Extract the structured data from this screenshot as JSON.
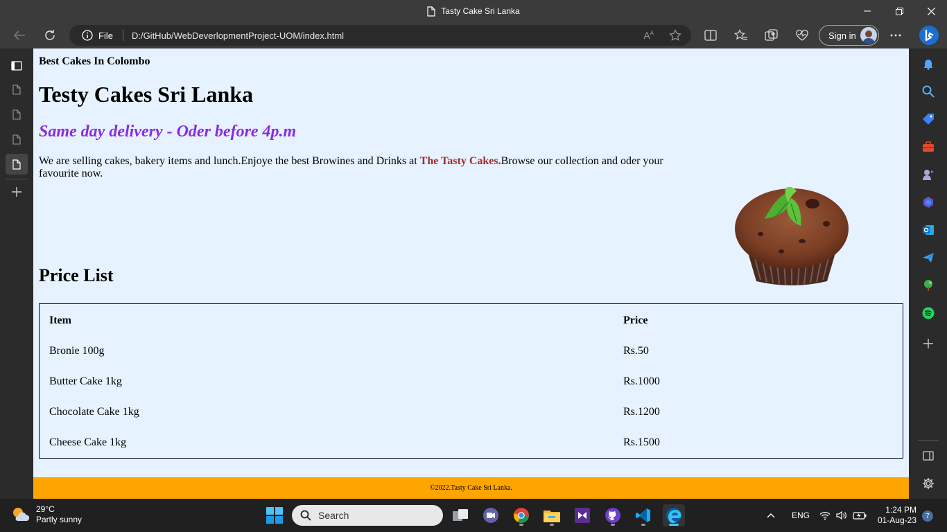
{
  "window": {
    "title": "Tasty Cake Sri Lanka",
    "minimize_icon": "minimize-icon",
    "restore_icon": "restore-icon",
    "close_icon": "close-icon"
  },
  "toolbar": {
    "info_label": "File",
    "url": "D:/GitHub/WebDeverlopmentProject-UOM/index.html",
    "signin_label": "Sign in"
  },
  "page": {
    "topline": "Best Cakes In Colombo",
    "heading": "Testy Cakes Sri Lanka",
    "tagline": "Same day delivery - Oder before 4p.m",
    "para_before": "We are selling cakes, bakery items and lunch.Enjoye the best Browines and Drinks at ",
    "para_brand": "The Tasty Cakes.",
    "para_after": "Browse our collection and oder your favourite now.",
    "price_title": "Price List",
    "table": {
      "headers": [
        "Item",
        "Price"
      ],
      "rows": [
        [
          "Bronie 100g",
          "Rs.50"
        ],
        [
          "Butter Cake 1kg",
          "Rs.1000"
        ],
        [
          "Chocolate Cake 1kg",
          "Rs.1200"
        ],
        [
          "Cheese Cake 1kg",
          "Rs.1500"
        ]
      ]
    },
    "footer": "©2022.Tasty Cake Sri Lanka.",
    "colors": {
      "background": "#e6f2ff",
      "tagline": "#8a2be2",
      "brand": "#a52a2a",
      "footer": "#ffa500"
    }
  },
  "taskbar": {
    "weather_temp": "29°C",
    "weather_desc": "Partly sunny",
    "search_placeholder": "Search",
    "language": "ENG",
    "time": "1:24 PM",
    "date": "01-Aug-23",
    "notification_count": "7"
  }
}
